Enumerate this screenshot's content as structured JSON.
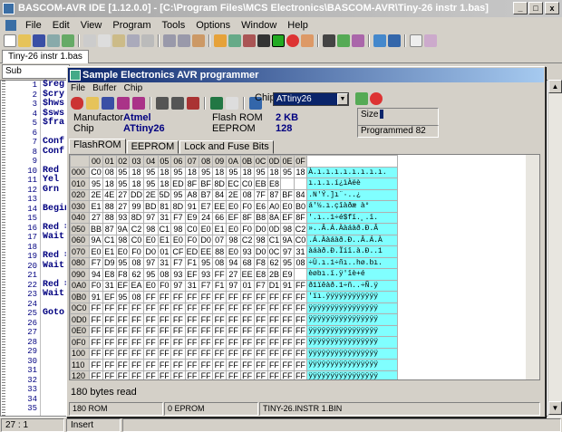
{
  "app": {
    "title": "BASCOM-AVR IDE [1.12.0.0] - [C:\\Program Files\\MCS Electronics\\BASCOM-AVR\\Tiny-26 instr 1.bas]",
    "min": "_",
    "max": "□",
    "close": "x"
  },
  "menu": [
    "File",
    "Edit",
    "View",
    "Program",
    "Tools",
    "Options",
    "Window",
    "Help"
  ],
  "file_tab": "Tiny-26 instr 1.bas",
  "sub_combo": "Sub",
  "editor": {
    "line_numbers": "1\n2\n3\n4\n5\n6\n7\n8\n9\n10\n11\n12\n13\n14\n15\n16\n17\n18\n19\n20\n21\n22\n23\n24\n25\n26\n27\n28\n29\n30\n31\n32\n33\n34\n35",
    "code": "$reg\n$cry\n$hws\n$sws\n$fra\n\nConf\nConf\n\nRed\nYel\nGrn\n\nBegin\n\nRed =\nWait\n\nRed =\nWait\n\nRed =\nWait\n\nGoto"
  },
  "status": {
    "pos": "27 : 1",
    "mode": "Insert"
  },
  "dialog": {
    "title": "Sample Electronics AVR programmer",
    "menu": [
      "File",
      "Buffer",
      "Chip"
    ],
    "chip_label": "Chip",
    "chip_value": "ATtiny26",
    "manufactor_label": "Manufactor",
    "manufactor_value": "Atmel",
    "chip_row_label": "Chip",
    "chip_row_value": "ATtiny26",
    "flashrom_label": "Flash ROM",
    "flashrom_value": "2 KB",
    "eeprom_label": "EEPROM",
    "eeprom_value": "128",
    "size_label": "Size",
    "programmed": "Programmed 82",
    "tabs": [
      "FlashROM",
      "EEPROM",
      "Lock and Fuse Bits"
    ],
    "bytes_read": "180 bytes read",
    "status": [
      "180 ROM",
      "0 EPROM",
      "TINY-26.INSTR 1.BIN"
    ],
    "hex_header": [
      "",
      "00",
      "01",
      "02",
      "03",
      "04",
      "05",
      "06",
      "07",
      "08",
      "09",
      "0A",
      "0B",
      "0C",
      "0D",
      "0E",
      "0F"
    ],
    "hex_rows": [
      {
        "addr": "000",
        "bytes": [
          "C0",
          "08",
          "95",
          "18",
          "95",
          "18",
          "95",
          "18",
          "95",
          "18",
          "95",
          "18",
          "95",
          "18",
          "95",
          "18"
        ],
        "ascii": "À.ı.ı.ı.ı.ı.ı.ı.ı."
      },
      {
        "addr": "010",
        "bytes": [
          "95",
          "18",
          "95",
          "18",
          "95",
          "18",
          "ED",
          "8F",
          "BF",
          "8D",
          "EC",
          "C0",
          "EB",
          "E8",
          "",
          ""
        ],
        "ascii": "ı.ı.ı.í¿ìÀëè"
      },
      {
        "addr": "020",
        "bytes": [
          "2E",
          "4E",
          "27",
          "DD",
          "2E",
          "5D",
          "95",
          "A8",
          "B7",
          "84",
          "2E",
          "08",
          "7F",
          "87",
          "BF",
          "84"
        ],
        "ascii": ".N'Ý.]ı¨·..¿"
      },
      {
        "addr": "030",
        "bytes": [
          "E1",
          "88",
          "27",
          "99",
          "BD",
          "81",
          "8D",
          "91",
          "E7",
          "EE",
          "E0",
          "F0",
          "E6",
          "A0",
          "E0",
          "B0"
        ],
        "ascii": "á'½.ı.çîàðæ à°"
      },
      {
        "addr": "040",
        "bytes": [
          "27",
          "88",
          "93",
          "8D",
          "97",
          "31",
          "F7",
          "E9",
          "24",
          "66",
          "EF",
          "8F",
          "B8",
          "8A",
          "EF",
          "8F"
        ],
        "ascii": "'.ı..1÷é$fï.¸.ï."
      },
      {
        "addr": "050",
        "bytes": [
          "BB",
          "87",
          "9A",
          "C2",
          "98",
          "C1",
          "98",
          "C0",
          "E0",
          "E1",
          "E0",
          "F0",
          "D0",
          "0D",
          "98",
          "C2"
        ],
        "ascii": "»..Â.Á.Ààáàð.Ð.Â"
      },
      {
        "addr": "060",
        "bytes": [
          "9A",
          "C1",
          "98",
          "C0",
          "E0",
          "E1",
          "E0",
          "F0",
          "D0",
          "07",
          "98",
          "C2",
          "98",
          "C1",
          "9A",
          "C0"
        ],
        "ascii": ".Á.Ààáàð.Ð..Â.Á.À"
      },
      {
        "addr": "070",
        "bytes": [
          "E0",
          "E1",
          "E0",
          "F0",
          "D0",
          "01",
          "CF",
          "ED",
          "EE",
          "88",
          "E0",
          "93",
          "D0",
          "0C",
          "97",
          "31"
        ],
        "ascii": "àáàð.Ð.Ïíî.à.Ð..1"
      },
      {
        "addr": "080",
        "bytes": [
          "F7",
          "D9",
          "95",
          "08",
          "97",
          "31",
          "F7",
          "F1",
          "95",
          "08",
          "94",
          "68",
          "F8",
          "62",
          "95",
          "08"
        ],
        "ascii": "÷Ù.ı.1÷ñı..hø.bı."
      },
      {
        "addr": "090",
        "bytes": [
          "94",
          "E8",
          "F8",
          "62",
          "95",
          "08",
          "93",
          "EF",
          "93",
          "FF",
          "27",
          "EE",
          "E8",
          "2B",
          "E9",
          ""
        ],
        "ascii": "èøbı.ï.ÿ'îè+é"
      },
      {
        "addr": "0A0",
        "bytes": [
          "F0",
          "31",
          "EF",
          "EA",
          "E0",
          "F0",
          "97",
          "31",
          "F7",
          "F1",
          "97",
          "01",
          "F7",
          "D1",
          "91",
          "FF"
        ],
        "ascii": "ð1ïêàð.1÷ñ..÷Ñ.ÿ"
      },
      {
        "addr": "0B0",
        "bytes": [
          "91",
          "EF",
          "95",
          "08",
          "FF",
          "FF",
          "FF",
          "FF",
          "FF",
          "FF",
          "FF",
          "FF",
          "FF",
          "FF",
          "FF",
          "FF"
        ],
        "ascii": "'ïı.ÿÿÿÿÿÿÿÿÿÿÿÿ"
      },
      {
        "addr": "0C0",
        "bytes": [
          "FF",
          "FF",
          "FF",
          "FF",
          "FF",
          "FF",
          "FF",
          "FF",
          "FF",
          "FF",
          "FF",
          "FF",
          "FF",
          "FF",
          "FF",
          "FF"
        ],
        "ascii": "ÿÿÿÿÿÿÿÿÿÿÿÿÿÿÿÿ"
      },
      {
        "addr": "0D0",
        "bytes": [
          "FF",
          "FF",
          "FF",
          "FF",
          "FF",
          "FF",
          "FF",
          "FF",
          "FF",
          "FF",
          "FF",
          "FF",
          "FF",
          "FF",
          "FF",
          "FF"
        ],
        "ascii": "ÿÿÿÿÿÿÿÿÿÿÿÿÿÿÿÿ"
      },
      {
        "addr": "0E0",
        "bytes": [
          "FF",
          "FF",
          "FF",
          "FF",
          "FF",
          "FF",
          "FF",
          "FF",
          "FF",
          "FF",
          "FF",
          "FF",
          "FF",
          "FF",
          "FF",
          "FF"
        ],
        "ascii": "ÿÿÿÿÿÿÿÿÿÿÿÿÿÿÿÿ"
      },
      {
        "addr": "0F0",
        "bytes": [
          "FF",
          "FF",
          "FF",
          "FF",
          "FF",
          "FF",
          "FF",
          "FF",
          "FF",
          "FF",
          "FF",
          "FF",
          "FF",
          "FF",
          "FF",
          "FF"
        ],
        "ascii": "ÿÿÿÿÿÿÿÿÿÿÿÿÿÿÿÿ"
      },
      {
        "addr": "100",
        "bytes": [
          "FF",
          "FF",
          "FF",
          "FF",
          "FF",
          "FF",
          "FF",
          "FF",
          "FF",
          "FF",
          "FF",
          "FF",
          "FF",
          "FF",
          "FF",
          "FF"
        ],
        "ascii": "ÿÿÿÿÿÿÿÿÿÿÿÿÿÿÿÿ"
      },
      {
        "addr": "110",
        "bytes": [
          "FF",
          "FF",
          "FF",
          "FF",
          "FF",
          "FF",
          "FF",
          "FF",
          "FF",
          "FF",
          "FF",
          "FF",
          "FF",
          "FF",
          "FF",
          "FF"
        ],
        "ascii": "ÿÿÿÿÿÿÿÿÿÿÿÿÿÿÿÿ"
      },
      {
        "addr": "120",
        "bytes": [
          "FF",
          "FF",
          "FF",
          "FF",
          "FF",
          "FF",
          "FF",
          "FF",
          "FF",
          "FF",
          "FF",
          "FF",
          "FF",
          "FF",
          "FF",
          "FF"
        ],
        "ascii": "ÿÿÿÿÿÿÿÿÿÿÿÿÿÿÿÿ"
      }
    ]
  },
  "colors": {
    "ascii_bg": "#80ffff",
    "dialog_title": "#0a246a",
    "code_text": "#000080"
  }
}
